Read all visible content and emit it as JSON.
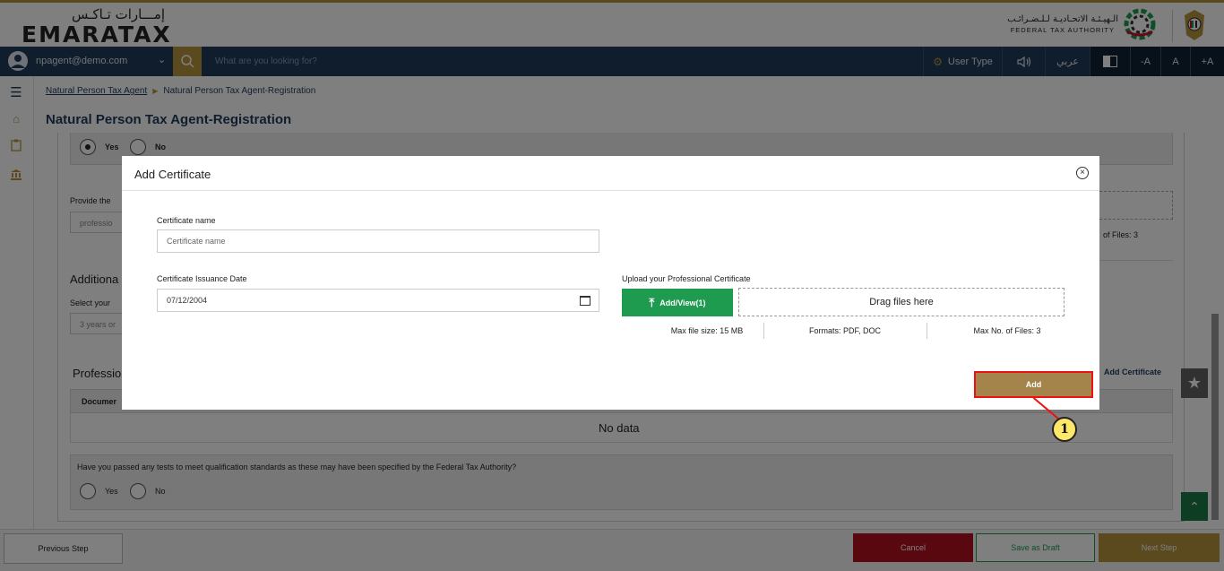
{
  "header": {
    "logo_ar": "إمـــارات تـاكـس",
    "logo_en": "EMARATAX",
    "authority_ar": "الـهيـئـة الاتحـاديـة لـلـضـرائـب",
    "authority_en": "FEDERAL TAX AUTHORITY"
  },
  "navbar": {
    "user": "npagent@demo.com",
    "search_placeholder": "What are you looking for?",
    "user_type": "User Type",
    "lang": "عربي",
    "font_small": "-A",
    "font_normal": "A",
    "font_large": "+A"
  },
  "breadcrumb": {
    "root": "Natural Person Tax Agent",
    "current": "Natural Person Tax Agent-Registration"
  },
  "page_title": "Natural Person Tax Agent-Registration",
  "background_form": {
    "yes": "Yes",
    "no": "No",
    "provide_label": "Provide the",
    "provide_value": "professio",
    "max_files_partial": "of Files: 3",
    "additional_title": "Additiona",
    "select_label": "Select your",
    "select_value": "3 years or",
    "professional_title": "Professio",
    "add_certificate_link": "Add Certificate",
    "doc_col": "Documer",
    "no_data": "No data",
    "tests_question": "Have you passed any tests to meet qualification standards as these may have been specified by the Federal Tax Authority?",
    "tests_yes": "Yes",
    "tests_no": "No"
  },
  "modal": {
    "title": "Add Certificate",
    "cert_name_label": "Certificate name",
    "cert_name_placeholder": "Certificate name",
    "issuance_label": "Certificate Issuance Date",
    "issuance_value": "07/12/2004",
    "upload_label": "Upload your Professional Certificate",
    "upload_button": "Add/View(1)",
    "drop_text": "Drag files here",
    "max_size": "Max file size: 15 MB",
    "formats": "Formats: PDF, DOC",
    "max_files": "Max No. of Files: 3",
    "add_button": "Add"
  },
  "callout_number": "1",
  "footer": {
    "previous": "Previous Step",
    "cancel": "Cancel",
    "save_draft": "Save as Draft",
    "next": "Next Step"
  },
  "colors": {
    "navy": "#1f3a5a",
    "gold": "#b8943f",
    "green": "#1e9b4f",
    "red": "#b3101e"
  }
}
